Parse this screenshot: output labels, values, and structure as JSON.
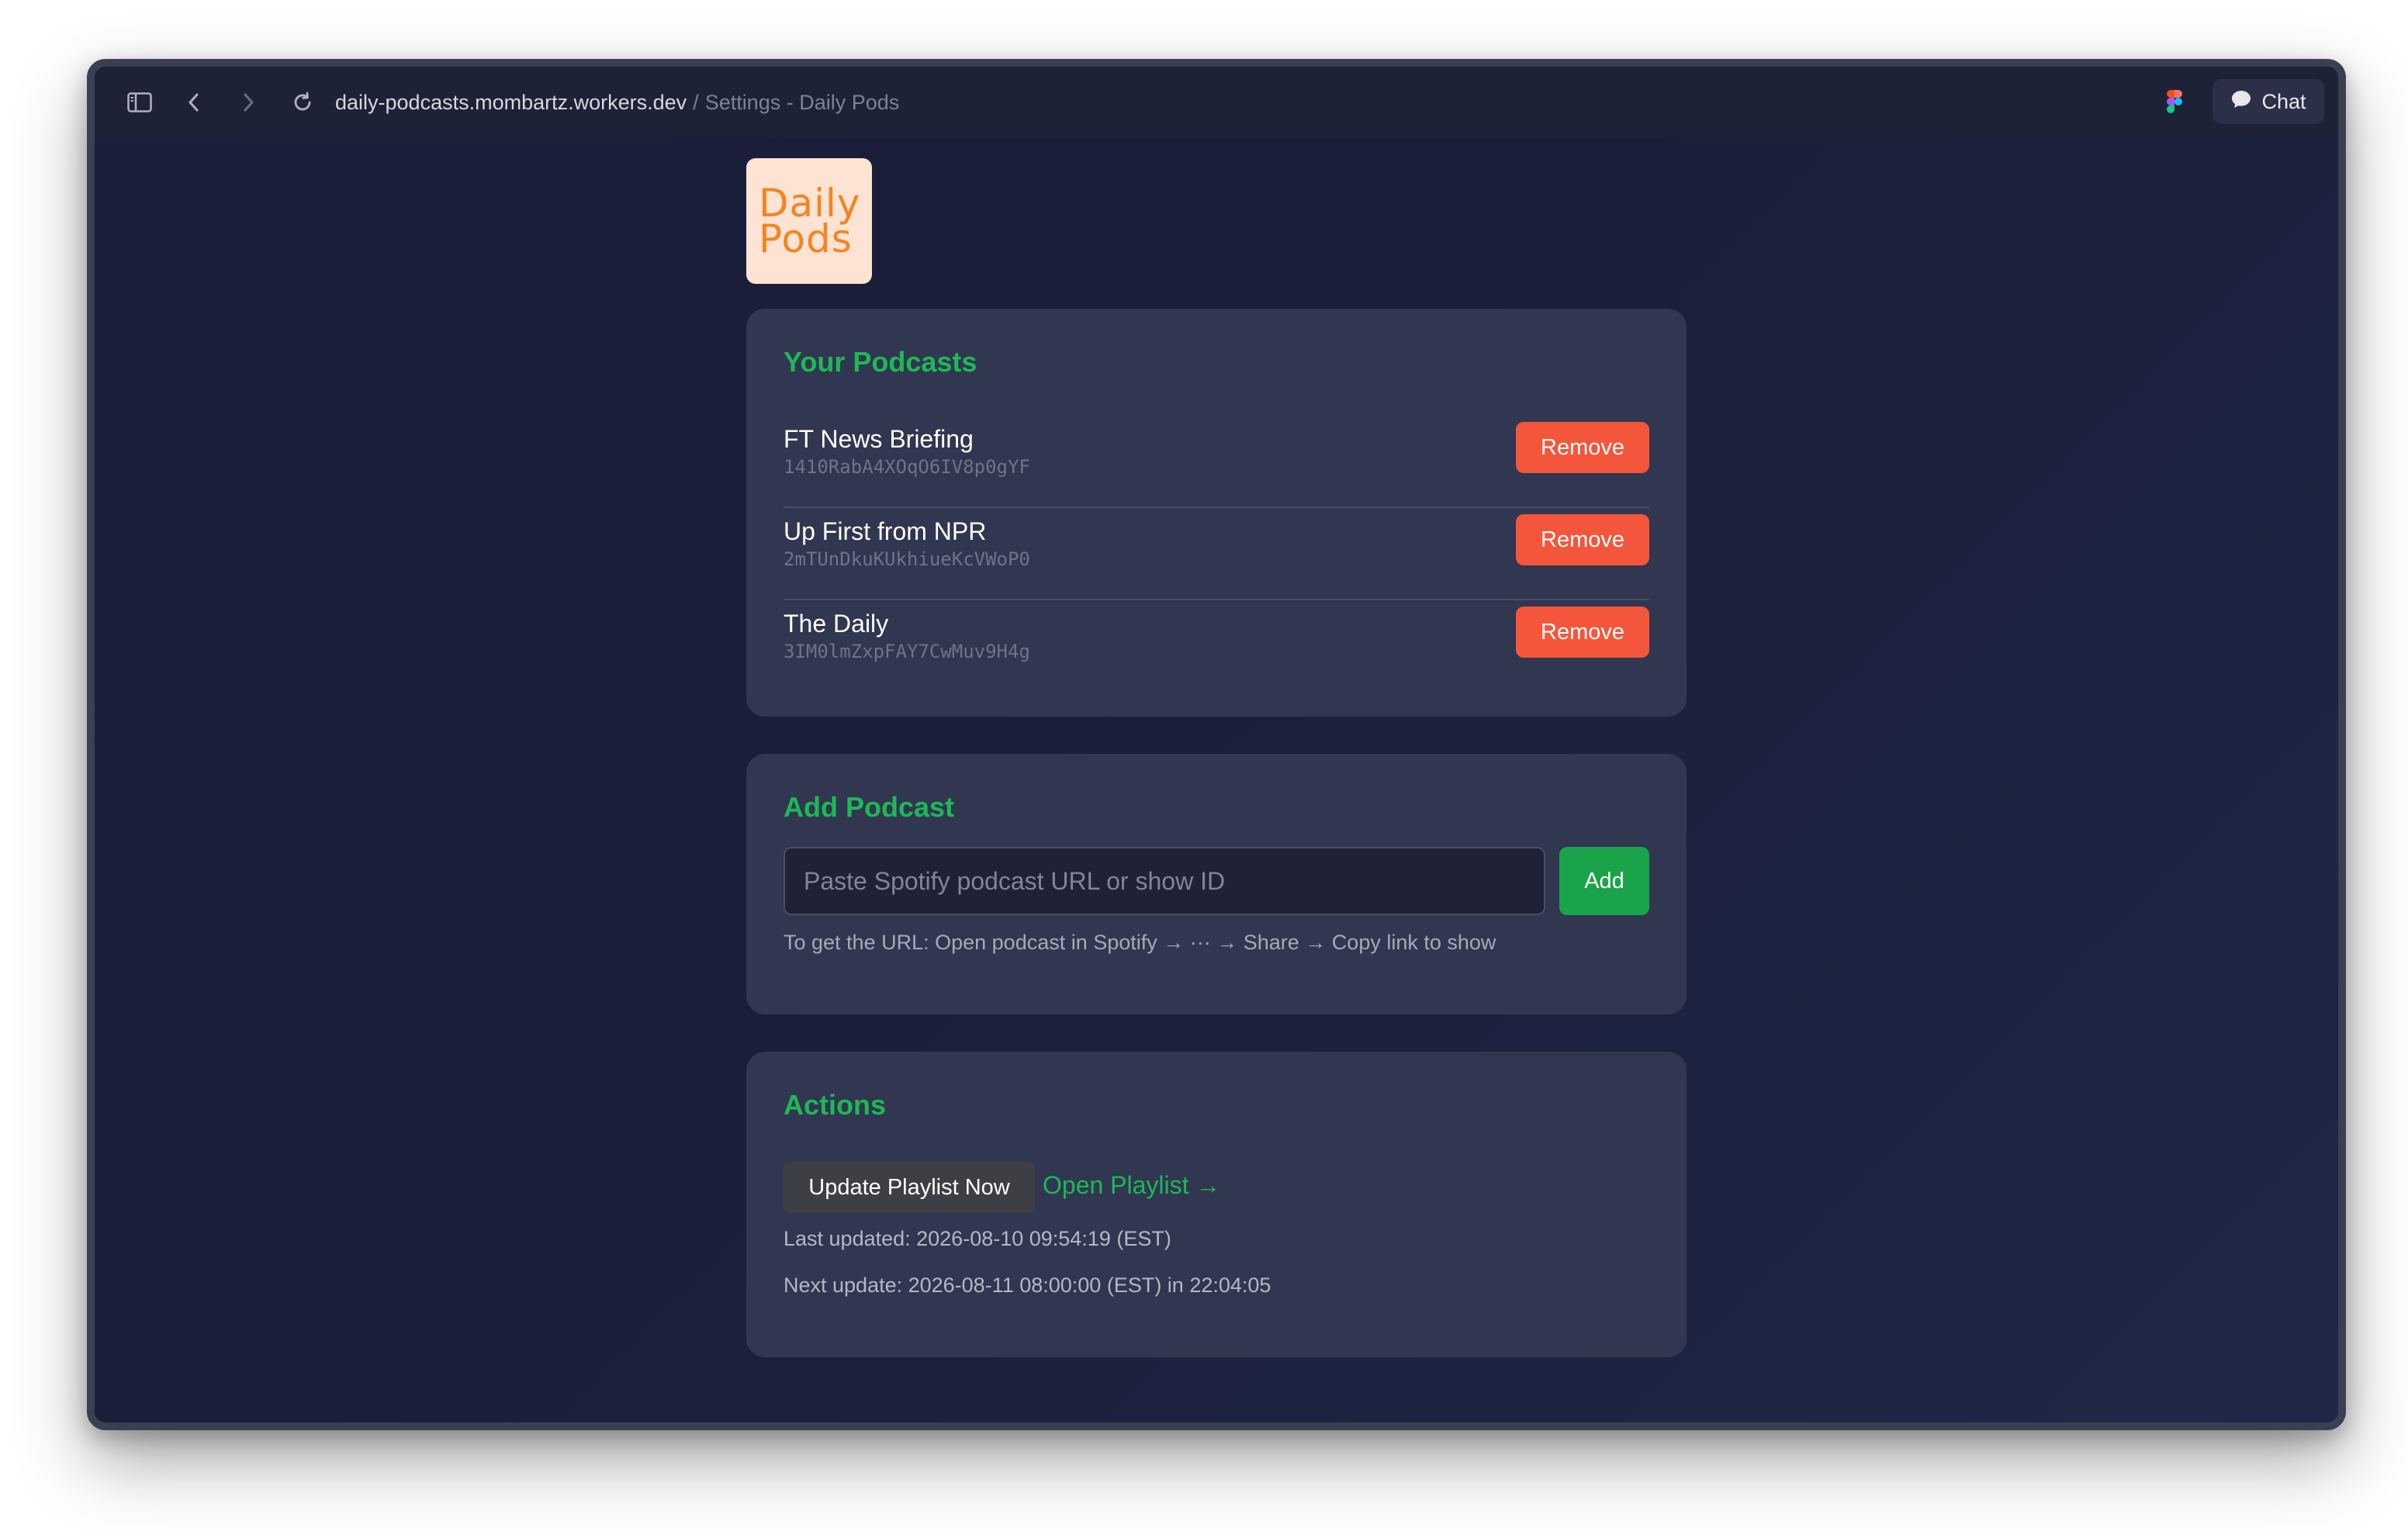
{
  "browser": {
    "url_domain": "daily-podcasts.mombartz.workers.dev",
    "url_separator": "/",
    "page_title": "Settings - Daily Pods",
    "chat_label": "Chat"
  },
  "logo": {
    "line1": "Daily",
    "line2": "Pods"
  },
  "podcasts_section": {
    "title": "Your Podcasts",
    "items": [
      {
        "name": "FT News Briefing",
        "id": "1410RabA4XOqO6IV8p0gYF",
        "action": "Remove"
      },
      {
        "name": "Up First from NPR",
        "id": "2mTUnDkuKUkhiueKcVWoP0",
        "action": "Remove"
      },
      {
        "name": "The Daily",
        "id": "3IM0lmZxpFAY7CwMuv9H4g",
        "action": "Remove"
      }
    ]
  },
  "add_section": {
    "title": "Add Podcast",
    "input_placeholder": "Paste Spotify podcast URL or show ID",
    "input_value": "",
    "add_label": "Add",
    "hint": "To get the URL: Open podcast in Spotify → ··· → Share → Copy link to show"
  },
  "actions_section": {
    "title": "Actions",
    "update_label": "Update Playlist Now",
    "open_label": "Open Playlist →",
    "last_updated": "Last updated: 2026-08-10 09:54:19 (EST)",
    "next_update": "Next update: 2026-08-11 08:00:00 (EST) in 22:04:05"
  },
  "colors": {
    "accent_green": "#1db954",
    "remove_red": "#f4563b",
    "add_green": "#1aa34a",
    "logo_orange": "#f58420",
    "logo_bg": "#fde3d3"
  },
  "icons": {
    "sidebar": "sidebar-toggle-icon",
    "back": "chevron-left-icon",
    "forward": "chevron-right-icon",
    "reload": "reload-icon",
    "figma": "figma-icon",
    "chat": "chat-bubble-icon"
  }
}
